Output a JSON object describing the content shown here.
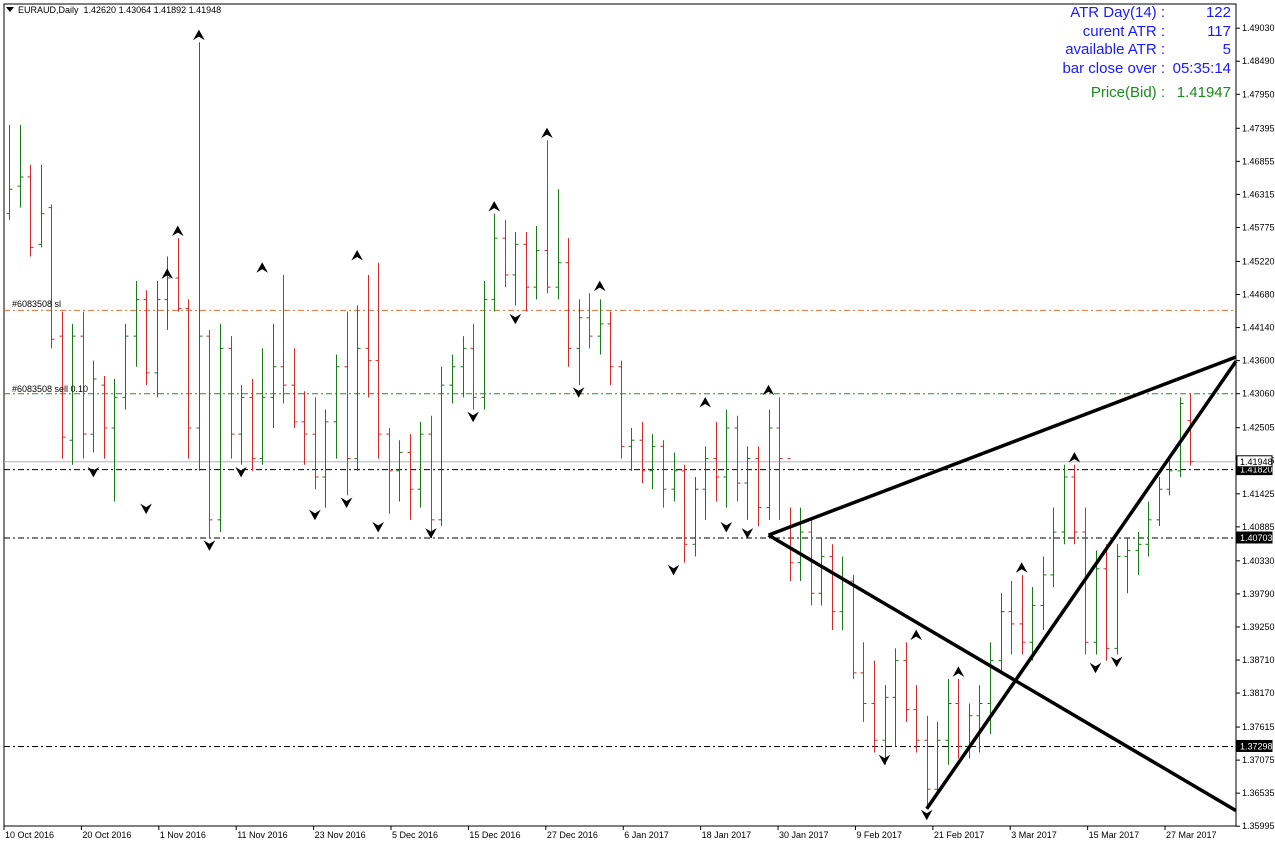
{
  "header": {
    "symbol": "EURAUD,Daily",
    "ohlc": "1.42620 1.43064 1.41892 1.41948"
  },
  "atr_panel": {
    "rows": [
      {
        "label": "ATR Day(14) :",
        "value": "122"
      },
      {
        "label": "curent ATR :",
        "value": "117"
      },
      {
        "label": "available ATR :",
        "value": "5"
      },
      {
        "label": "bar close over :",
        "value": "05:35:14"
      }
    ],
    "price_label": "Price(Bid) :",
    "price_value": "1.41947"
  },
  "order_labels": {
    "sl": "#6083508 sl",
    "sell": "#6083508 sell 0.10"
  },
  "colors": {
    "up_bar": "#1a7a1a",
    "down_bar": "#d22a2a",
    "sl_line": "#e0703a",
    "entry_line": "#2a8a2a",
    "hline": "#000000",
    "trend": "#000000",
    "atr_text": "#1a1aff",
    "price_text": "#1a8a1a"
  },
  "chart_data": {
    "type": "ohlc",
    "ylim": [
      1.35999,
      1.49425
    ],
    "y_ticks": [
      "1.49030",
      "1.48490",
      "1.47950",
      "1.47395",
      "1.46855",
      "1.46315",
      "1.45775",
      "1.45220",
      "1.44680",
      "1.44140",
      "1.43600",
      "1.43060",
      "1.42505",
      "1.41965",
      "1.41425",
      "1.40885",
      "1.40330",
      "1.39790",
      "1.39250",
      "1.38710",
      "1.38170",
      "1.37615",
      "1.37075",
      "1.36535",
      "1.35995"
    ],
    "x_labels": [
      "10 Oct 2016",
      "20 Oct 2016",
      "1 Nov 2016",
      "11 Nov 2016",
      "23 Nov 2016",
      "5 Dec 2016",
      "15 Dec 2016",
      "27 Dec 2016",
      "6 Jan 2017",
      "18 Jan 2017",
      "30 Jan 2017",
      "9 Feb 2017",
      "21 Feb 2017",
      "3 Mar 2017",
      "15 Mar 2017",
      "27 Mar 2017"
    ],
    "horizontal_levels": [
      {
        "value": 1.4442,
        "style": "sl"
      },
      {
        "value": 1.4306,
        "style": "entry"
      },
      {
        "value": 1.4182,
        "style": "level",
        "label": "1.41820"
      },
      {
        "value": 1.40703,
        "style": "level",
        "label": "1.40703"
      },
      {
        "value": 1.37298,
        "style": "level",
        "label": "1.37298"
      }
    ],
    "current_price": {
      "value": 1.41948,
      "label": "1.41948"
    },
    "trendlines": [
      {
        "from": [
          "31 Jan 2017",
          1.4075
        ],
        "to": [
          "31 Mar 2017",
          1.4366
        ]
      },
      {
        "from": [
          "31 Jan 2017",
          1.4075
        ],
        "to": [
          "31 Mar 2017",
          1.3625
        ]
      },
      {
        "from": [
          "21 Feb 2017",
          1.3628
        ],
        "to": [
          "31 Mar 2017",
          1.4359
        ]
      }
    ],
    "bars": [
      [
        1.46,
        1.4745,
        1.459,
        1.464
      ],
      [
        1.4645,
        1.4745,
        1.461,
        1.466
      ],
      [
        1.466,
        1.468,
        1.453,
        1.4545
      ],
      [
        1.455,
        1.468,
        1.4545,
        1.46
      ],
      [
        1.461,
        1.4615,
        1.438,
        1.4395
      ],
      [
        1.44,
        1.444,
        1.42,
        1.4235
      ],
      [
        1.423,
        1.442,
        1.419,
        1.44
      ],
      [
        1.44,
        1.444,
        1.42,
        1.424
      ],
      [
        1.424,
        1.436,
        1.421,
        1.433
      ],
      [
        1.432,
        1.4335,
        1.42,
        1.425
      ],
      [
        1.425,
        1.433,
        1.413,
        1.43
      ],
      [
        1.43,
        1.442,
        1.428,
        1.44
      ],
      [
        1.44,
        1.449,
        1.435,
        1.446
      ],
      [
        1.446,
        1.4475,
        1.432,
        1.434
      ],
      [
        1.434,
        1.449,
        1.43,
        1.446
      ],
      [
        1.446,
        1.453,
        1.441,
        1.4495
      ],
      [
        1.4495,
        1.456,
        1.444,
        1.4445
      ],
      [
        1.4445,
        1.446,
        1.42,
        1.425
      ],
      [
        1.425,
        1.488,
        1.418,
        1.44
      ],
      [
        1.44,
        1.441,
        1.407,
        1.41
      ],
      [
        1.41,
        1.442,
        1.408,
        1.438
      ],
      [
        1.438,
        1.44,
        1.42,
        1.424
      ],
      [
        1.424,
        1.432,
        1.419,
        1.43
      ],
      [
        1.43,
        1.433,
        1.418,
        1.42
      ],
      [
        1.42,
        1.438,
        1.419,
        1.43
      ],
      [
        1.43,
        1.442,
        1.425,
        1.435
      ],
      [
        1.435,
        1.45,
        1.429,
        1.432
      ],
      [
        1.432,
        1.438,
        1.425,
        1.426
      ],
      [
        1.426,
        1.431,
        1.419,
        1.424
      ],
      [
        1.424,
        1.43,
        1.415,
        1.417
      ],
      [
        1.417,
        1.428,
        1.412,
        1.426
      ],
      [
        1.426,
        1.437,
        1.42,
        1.435
      ],
      [
        1.435,
        1.444,
        1.414,
        1.42
      ],
      [
        1.42,
        1.445,
        1.418,
        1.438
      ],
      [
        1.438,
        1.45,
        1.43,
        1.436
      ],
      [
        1.436,
        1.452,
        1.42,
        1.424
      ],
      [
        1.424,
        1.425,
        1.411,
        1.418
      ],
      [
        1.418,
        1.423,
        1.413,
        1.421
      ],
      [
        1.421,
        1.424,
        1.41,
        1.415
      ],
      [
        1.415,
        1.426,
        1.412,
        1.424
      ],
      [
        1.424,
        1.427,
        1.407,
        1.41
      ],
      [
        1.41,
        1.435,
        1.409,
        1.432
      ],
      [
        1.432,
        1.437,
        1.429,
        1.435
      ],
      [
        1.435,
        1.44,
        1.43,
        1.438
      ],
      [
        1.438,
        1.442,
        1.428,
        1.43
      ],
      [
        1.43,
        1.449,
        1.428,
        1.446
      ],
      [
        1.446,
        1.46,
        1.444,
        1.456
      ],
      [
        1.456,
        1.459,
        1.448,
        1.45
      ],
      [
        1.45,
        1.457,
        1.445,
        1.455
      ],
      [
        1.455,
        1.457,
        1.444,
        1.448
      ],
      [
        1.448,
        1.458,
        1.446,
        1.454
      ],
      [
        1.454,
        1.472,
        1.447,
        1.448
      ],
      [
        1.448,
        1.464,
        1.446,
        1.452
      ],
      [
        1.452,
        1.456,
        1.435,
        1.438
      ],
      [
        1.438,
        1.446,
        1.432,
        1.443
      ],
      [
        1.443,
        1.447,
        1.438,
        1.44
      ],
      [
        1.44,
        1.446,
        1.437,
        1.442
      ],
      [
        1.442,
        1.444,
        1.432,
        1.435
      ],
      [
        1.435,
        1.436,
        1.42,
        1.422
      ],
      [
        1.422,
        1.425,
        1.418,
        1.423
      ],
      [
        1.423,
        1.426,
        1.416,
        1.418
      ],
      [
        1.418,
        1.424,
        1.415,
        1.422
      ],
      [
        1.422,
        1.423,
        1.412,
        1.415
      ],
      [
        1.415,
        1.421,
        1.413,
        1.418
      ],
      [
        1.418,
        1.419,
        1.403,
        1.406
      ],
      [
        1.406,
        1.417,
        1.404,
        1.415
      ],
      [
        1.415,
        1.422,
        1.41,
        1.42
      ],
      [
        1.42,
        1.426,
        1.413,
        1.417
      ],
      [
        1.417,
        1.428,
        1.412,
        1.425
      ],
      [
        1.425,
        1.427,
        1.413,
        1.416
      ],
      [
        1.416,
        1.422,
        1.41,
        1.42
      ],
      [
        1.42,
        1.422,
        1.409,
        1.412
      ],
      [
        1.412,
        1.428,
        1.41,
        1.425
      ],
      [
        1.425,
        1.43,
        1.41,
        1.42
      ],
      [
        1.42,
        1.412,
        1.4,
        1.403
      ],
      [
        1.403,
        1.412,
        1.4,
        1.408
      ],
      [
        1.408,
        1.41,
        1.396,
        1.398
      ],
      [
        1.398,
        1.407,
        1.396,
        1.404
      ],
      [
        1.404,
        1.406,
        1.392,
        1.395
      ],
      [
        1.395,
        1.404,
        1.392,
        1.4
      ],
      [
        1.4,
        1.401,
        1.384,
        1.385
      ],
      [
        1.385,
        1.39,
        1.377,
        1.38
      ],
      [
        1.38,
        1.387,
        1.372,
        1.374
      ],
      [
        1.374,
        1.383,
        1.37,
        1.381
      ],
      [
        1.381,
        1.389,
        1.373,
        1.387
      ],
      [
        1.387,
        1.39,
        1.377,
        1.379
      ],
      [
        1.379,
        1.383,
        1.372,
        1.374
      ],
      [
        1.374,
        1.378,
        1.363,
        1.366
      ],
      [
        1.366,
        1.377,
        1.365,
        1.374
      ],
      [
        1.374,
        1.384,
        1.37,
        1.38
      ],
      [
        1.38,
        1.384,
        1.371,
        1.373
      ],
      [
        1.373,
        1.38,
        1.371,
        1.378
      ],
      [
        1.378,
        1.383,
        1.372,
        1.38
      ],
      [
        1.38,
        1.39,
        1.375,
        1.387
      ],
      [
        1.387,
        1.398,
        1.385,
        1.395
      ],
      [
        1.395,
        1.4,
        1.388,
        1.393
      ],
      [
        1.393,
        1.401,
        1.388,
        1.39
      ],
      [
        1.39,
        1.399,
        1.387,
        1.396
      ],
      [
        1.396,
        1.404,
        1.392,
        1.401
      ],
      [
        1.401,
        1.412,
        1.399,
        1.408
      ],
      [
        1.408,
        1.419,
        1.406,
        1.417
      ],
      [
        1.417,
        1.419,
        1.406,
        1.408
      ],
      [
        1.408,
        1.412,
        1.388,
        1.39
      ],
      [
        1.39,
        1.405,
        1.388,
        1.402
      ],
      [
        1.402,
        1.406,
        1.387,
        1.389
      ],
      [
        1.389,
        1.406,
        1.388,
        1.404
      ],
      [
        1.404,
        1.407,
        1.398,
        1.405
      ],
      [
        1.405,
        1.408,
        1.401,
        1.406
      ],
      [
        1.406,
        1.413,
        1.404,
        1.41
      ],
      [
        1.41,
        1.417,
        1.409,
        1.415
      ],
      [
        1.415,
        1.42,
        1.414,
        1.418
      ],
      [
        1.418,
        1.43,
        1.417,
        1.429
      ],
      [
        1.4262,
        1.4306,
        1.4189,
        1.4195
      ]
    ],
    "fractals": [
      {
        "bar": 8,
        "type": "down",
        "value": 1.419
      },
      {
        "bar": 13,
        "type": "down",
        "value": 1.413
      },
      {
        "bar": 15,
        "type": "up",
        "value": 1.449
      },
      {
        "bar": 16,
        "type": "up",
        "value": 1.456
      },
      {
        "bar": 18,
        "type": "up",
        "value": 1.488
      },
      {
        "bar": 19,
        "type": "down",
        "value": 1.407
      },
      {
        "bar": 22,
        "type": "down",
        "value": 1.419
      },
      {
        "bar": 24,
        "type": "up",
        "value": 1.45
      },
      {
        "bar": 29,
        "type": "down",
        "value": 1.412
      },
      {
        "bar": 32,
        "type": "down",
        "value": 1.414
      },
      {
        "bar": 33,
        "type": "up",
        "value": 1.452
      },
      {
        "bar": 35,
        "type": "down",
        "value": 1.41
      },
      {
        "bar": 40,
        "type": "down",
        "value": 1.409
      },
      {
        "bar": 44,
        "type": "down",
        "value": 1.428
      },
      {
        "bar": 46,
        "type": "up",
        "value": 1.46
      },
      {
        "bar": 48,
        "type": "down",
        "value": 1.444
      },
      {
        "bar": 51,
        "type": "up",
        "value": 1.472
      },
      {
        "bar": 54,
        "type": "down",
        "value": 1.432
      },
      {
        "bar": 56,
        "type": "up",
        "value": 1.447
      },
      {
        "bar": 63,
        "type": "down",
        "value": 1.403
      },
      {
        "bar": 66,
        "type": "up",
        "value": 1.428
      },
      {
        "bar": 68,
        "type": "down",
        "value": 1.41
      },
      {
        "bar": 70,
        "type": "down",
        "value": 1.409
      },
      {
        "bar": 72,
        "type": "up",
        "value": 1.43
      },
      {
        "bar": 83,
        "type": "down",
        "value": 1.372
      },
      {
        "bar": 86,
        "type": "up",
        "value": 1.39
      },
      {
        "bar": 87,
        "type": "down",
        "value": 1.363
      },
      {
        "bar": 90,
        "type": "up",
        "value": 1.384
      },
      {
        "bar": 96,
        "type": "up",
        "value": 1.401
      },
      {
        "bar": 101,
        "type": "up",
        "value": 1.419
      },
      {
        "bar": 103,
        "type": "down",
        "value": 1.387
      },
      {
        "bar": 105,
        "type": "down",
        "value": 1.388
      }
    ]
  }
}
